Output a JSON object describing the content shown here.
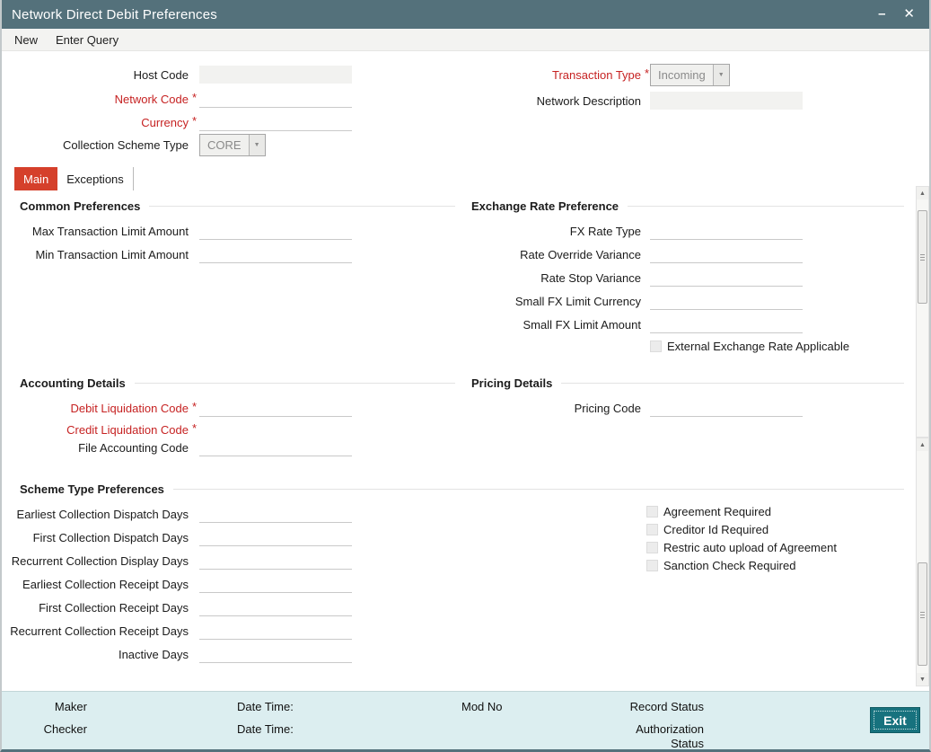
{
  "window": {
    "title": "Network Direct Debit Preferences",
    "minimize_icon": "–",
    "close_icon": "✕"
  },
  "toolbar": {
    "new_label": "New",
    "enter_query_label": "Enter Query"
  },
  "ui": {
    "required_marker": "*",
    "dropdown_arrow": "▼",
    "scroll_up": "▲",
    "scroll_down": "▼"
  },
  "colors": {
    "titlebar": "#54717b",
    "active_tab": "#d5402b",
    "required_label": "#c62222",
    "footer_bg": "#dceef0",
    "exit_button": "#17727e"
  },
  "header_fields": {
    "host_code_label": "Host Code",
    "host_code_value": "",
    "network_code_label": "Network Code",
    "network_code_value": "",
    "currency_label": "Currency",
    "currency_value": "",
    "collection_scheme_type_label": "Collection Scheme Type",
    "collection_scheme_type_value": "CORE",
    "transaction_type_label": "Transaction Type",
    "transaction_type_value": "Incoming",
    "network_description_label": "Network Description",
    "network_description_value": ""
  },
  "tabs": {
    "main": "Main",
    "exceptions": "Exceptions"
  },
  "common_preferences": {
    "heading": "Common Preferences",
    "max_transaction_limit_amount_label": "Max Transaction Limit Amount",
    "min_transaction_limit_amount_label": "Min Transaction Limit Amount"
  },
  "exchange_rate_preference": {
    "heading": "Exchange Rate Preference",
    "fx_rate_type_label": "FX Rate Type",
    "rate_override_variance_label": "Rate Override Variance",
    "rate_stop_variance_label": "Rate Stop Variance",
    "small_fx_limit_currency_label": "Small FX Limit Currency",
    "small_fx_limit_amount_label": "Small FX Limit Amount",
    "external_exchange_rate_applicable_label": "External Exchange Rate Applicable"
  },
  "accounting_details": {
    "heading": "Accounting Details",
    "debit_liquidation_code_label": "Debit Liquidation Code",
    "credit_liquidation_code_label": "Credit Liquidation Code",
    "file_accounting_code_label": "File Accounting Code"
  },
  "pricing_details": {
    "heading": "Pricing Details",
    "pricing_code_label": "Pricing Code"
  },
  "scheme_type_preferences": {
    "heading": "Scheme Type Preferences",
    "rows": [
      "Earliest Collection Dispatch Days",
      "First Collection Dispatch Days",
      "Recurrent Collection Display Days",
      "Earliest Collection Receipt Days",
      "First Collection Receipt Days",
      "Recurrent Collection Receipt Days",
      "Inactive Days"
    ],
    "checkboxes": [
      "Agreement Required",
      "Creditor Id Required",
      "Restric auto upload of Agreement",
      "Sanction Check Required"
    ]
  },
  "footer": {
    "maker_label": "Maker",
    "checker_label": "Checker",
    "maker_date_time_label": "Date Time:",
    "checker_date_time_label": "Date Time:",
    "mod_no_label": "Mod No",
    "record_status_label": "Record Status",
    "authorization_status_label": "Authorization Status",
    "exit_button_label": "Exit"
  }
}
